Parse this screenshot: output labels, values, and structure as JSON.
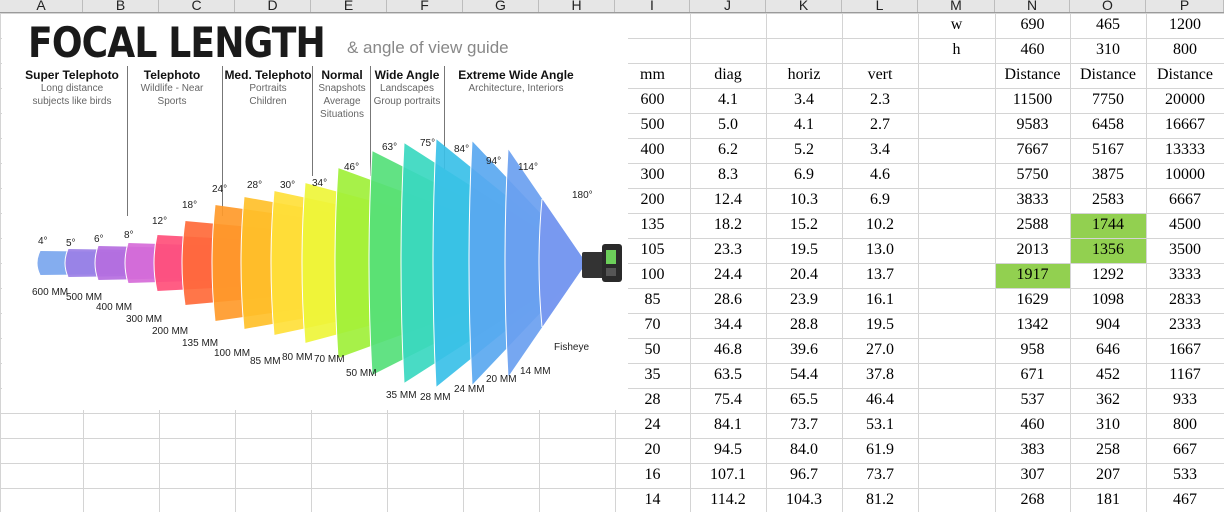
{
  "column_headers": [
    "A",
    "B",
    "C",
    "D",
    "E",
    "F",
    "G",
    "H",
    "I",
    "J",
    "K",
    "L",
    "M",
    "N",
    "O",
    "P"
  ],
  "params": {
    "w_label": "w",
    "h_label": "h",
    "w": [
      "690",
      "465",
      "1200"
    ],
    "h": [
      "460",
      "310",
      "800"
    ]
  },
  "table": {
    "headers": [
      "mm",
      "diag",
      "horiz",
      "vert"
    ],
    "distance_label": "Distance",
    "rows": [
      [
        "600",
        "4.1",
        "3.4",
        "2.3",
        "11500",
        "7750",
        "20000"
      ],
      [
        "500",
        "5.0",
        "4.1",
        "2.7",
        "9583",
        "6458",
        "16667"
      ],
      [
        "400",
        "6.2",
        "5.2",
        "3.4",
        "7667",
        "5167",
        "13333"
      ],
      [
        "300",
        "8.3",
        "6.9",
        "4.6",
        "5750",
        "3875",
        "10000"
      ],
      [
        "200",
        "12.4",
        "10.3",
        "6.9",
        "3833",
        "2583",
        "6667"
      ],
      [
        "135",
        "18.2",
        "15.2",
        "10.2",
        "2588",
        "1744",
        "4500"
      ],
      [
        "105",
        "23.3",
        "19.5",
        "13.0",
        "2013",
        "1356",
        "3500"
      ],
      [
        "100",
        "24.4",
        "20.4",
        "13.7",
        "1917",
        "1292",
        "3333"
      ],
      [
        "85",
        "28.6",
        "23.9",
        "16.1",
        "1629",
        "1098",
        "2833"
      ],
      [
        "70",
        "34.4",
        "28.8",
        "19.5",
        "1342",
        "904",
        "2333"
      ],
      [
        "50",
        "46.8",
        "39.6",
        "27.0",
        "958",
        "646",
        "1667"
      ],
      [
        "35",
        "63.5",
        "54.4",
        "37.8",
        "671",
        "452",
        "1167"
      ],
      [
        "28",
        "75.4",
        "65.5",
        "46.4",
        "537",
        "362",
        "933"
      ],
      [
        "24",
        "84.1",
        "73.7",
        "53.1",
        "460",
        "310",
        "800"
      ],
      [
        "20",
        "94.5",
        "84.0",
        "61.9",
        "383",
        "258",
        "667"
      ],
      [
        "16",
        "107.1",
        "96.7",
        "73.7",
        "307",
        "207",
        "533"
      ],
      [
        "14",
        "114.2",
        "104.3",
        "81.2",
        "268",
        "181",
        "467"
      ]
    ]
  },
  "highlight_color": "#92d050",
  "highlights": [
    {
      "row": 5,
      "col": 5
    },
    {
      "row": 6,
      "col": 5
    },
    {
      "row": 7,
      "col": 4
    }
  ],
  "infographic": {
    "title": "FOCAL LENGTH",
    "subtitle": "& angle of view guide",
    "categories": [
      {
        "name": "Super Telephoto",
        "desc": [
          "Long distance",
          "subjects like birds"
        ]
      },
      {
        "name": "Telephoto",
        "desc": [
          "Wildlife - Near",
          "Sports"
        ]
      },
      {
        "name": "Med. Telephoto",
        "desc": [
          "Portraits",
          "Children"
        ]
      },
      {
        "name": "Normal",
        "desc": [
          "Snapshots",
          "Average",
          "Situations"
        ]
      },
      {
        "name": "Wide Angle",
        "desc": [
          "Landscapes",
          "Group portraits"
        ]
      },
      {
        "name": "Extreme Wide Angle",
        "desc": [
          "Architecture, Interiors"
        ]
      }
    ],
    "angles": [
      "4°",
      "5°",
      "6°",
      "8°",
      "12°",
      "18°",
      "24°",
      "28°",
      "30°",
      "34°",
      "46°",
      "63°",
      "75°",
      "84°",
      "94°",
      "114°",
      "180°"
    ],
    "lenses": [
      "600 MM",
      "500 MM",
      "400 MM",
      "300 MM",
      "200 MM",
      "135 MM",
      "100 MM",
      "85 MM",
      "80 MM",
      "70 MM",
      "50 MM",
      "35 MM",
      "28 MM",
      "24 MM",
      "20 MM",
      "14 MM",
      "Fisheye"
    ],
    "colors": [
      "#7aa6ee",
      "#9b7fe6",
      "#b56ee0",
      "#d66bd8",
      "#ff4f7a",
      "#ff6a3a",
      "#ff9a2a",
      "#ffc02a",
      "#ffe03a",
      "#eef53a",
      "#9ff03a",
      "#55e07a",
      "#3ad8c0",
      "#3ac0e8",
      "#5aa8f0",
      "#6aa0f0",
      "#7a98f0"
    ]
  }
}
